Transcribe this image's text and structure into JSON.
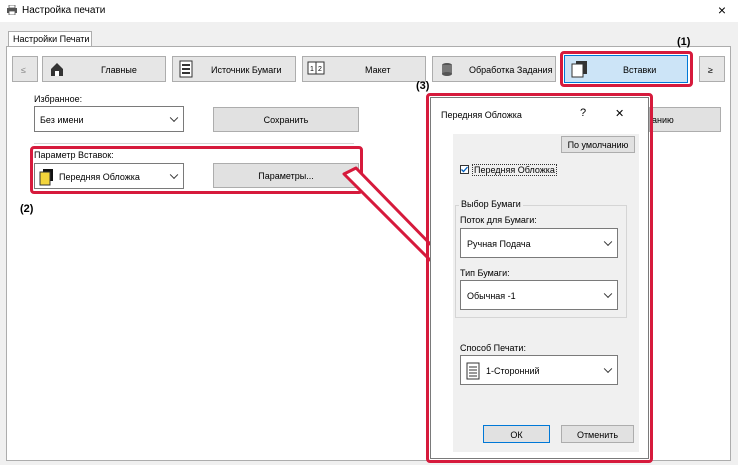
{
  "window": {
    "title": "Настройка печати",
    "close": "×"
  },
  "tab": {
    "label": "Настройки Печати"
  },
  "nav": {
    "prev": "≤",
    "next": "≥",
    "items": [
      {
        "label": "Главные",
        "icon": "home-icon"
      },
      {
        "label": "Источник Бумаги",
        "icon": "paper-tray-icon"
      },
      {
        "label": "Макет",
        "icon": "layout-icon"
      },
      {
        "label": "Обработка Задания",
        "icon": "job-handling-icon"
      },
      {
        "label": "Вставки",
        "icon": "inserts-icon"
      }
    ]
  },
  "favorites": {
    "label": "Избранное:",
    "value": "Без имени",
    "save": "Сохранить",
    "defaults_partial": "анию"
  },
  "insert_params": {
    "label": "Параметр Вставок:",
    "value": "Передняя Обложка",
    "params_button": "Параметры..."
  },
  "callouts": {
    "c1": "(1)",
    "c2": "(2)",
    "c3": "(3)"
  },
  "dialog": {
    "title": "Передняя Обложка",
    "help": "?",
    "close": "✕",
    "default_button": "По умолчанию",
    "checkbox_label": "Передняя Обложка",
    "checkbox_checked": true,
    "paper_group": "Выбор Бумаги",
    "source_label": "Поток для Бумаги:",
    "source_value": "Ручная Подача",
    "type_label": "Тип Бумаги:",
    "type_value": "Обычная -1",
    "print_label": "Способ Печати:",
    "print_value": "1-Сторонний",
    "ok": "ОК",
    "cancel": "Отменить"
  },
  "colors": {
    "highlight": "#d61a3c",
    "selected_tab": "#cce4f7"
  }
}
